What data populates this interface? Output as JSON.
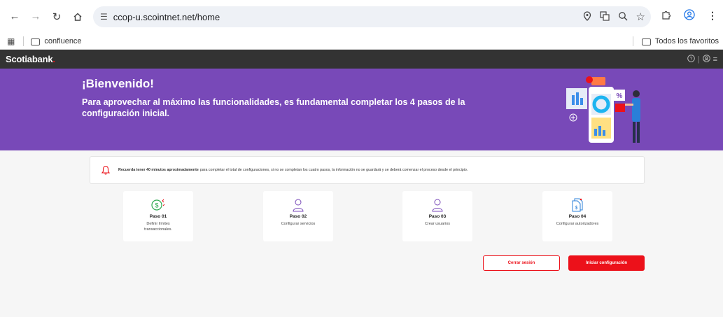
{
  "browser": {
    "url": "ccop-u.scointnet.net/home",
    "bookmarks": [
      {
        "label": "confluence"
      }
    ],
    "favorites_label": "Todos los favoritos"
  },
  "app": {
    "brand": "Scotiabank",
    "brand_dot": "."
  },
  "banner": {
    "title": "¡Bienvenido!",
    "subtitle": "Para aprovechar al máximo las funcionalidades, es fundamental completar los 4 pasos de la configuración inicial."
  },
  "notice": {
    "bold_text": "Recuerda tener 40 minutos aproximadamente",
    "text": "para completar el total de configuraciones, si no se completan los cuatro pasos, la información no se guardará y se deberá comenzar el proceso desde el principio."
  },
  "steps": [
    {
      "title": "Paso 01",
      "description": "Definir límites transaccionales.",
      "icon": "money-exchange-icon"
    },
    {
      "title": "Paso 02",
      "description": "Configurar servicios",
      "icon": "user-icon"
    },
    {
      "title": "Paso 03",
      "description": "Crear usuarios",
      "icon": "user-icon"
    },
    {
      "title": "Paso 04",
      "description": "Configurar autorizadores",
      "icon": "document-money-icon"
    }
  ],
  "buttons": {
    "logout": "Cerrar sesión",
    "start": "Iniciar configuración"
  },
  "colors": {
    "brand_red": "#ec111a",
    "banner_purple": "#7849b8",
    "header_dark": "#333333"
  }
}
